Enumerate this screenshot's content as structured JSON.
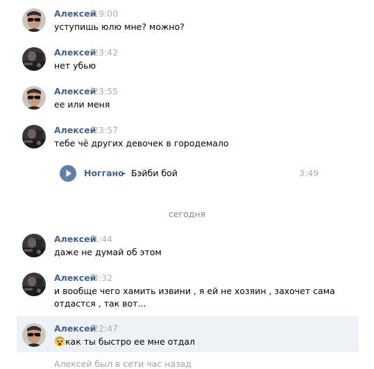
{
  "messages": [
    {
      "author": "Алексей",
      "time": "19:00",
      "text": "уступишь юлю мне? можно?",
      "avatar": "sunglasses"
    },
    {
      "author": "Алексей",
      "time": "23:42",
      "text": "нет убью",
      "avatar": "dark"
    },
    {
      "author": "Алексей",
      "time": "23:55",
      "text": "ее или меня",
      "avatar": "sunglasses"
    },
    {
      "author": "Алексей",
      "time": "23:57",
      "text": "тебе чё других девочек в городемало",
      "avatar": "dark"
    },
    {
      "author": "Алексей",
      "time": "1:44",
      "text": "даже не думай об этом",
      "avatar": "dark"
    },
    {
      "author": "Алексей",
      "time": "3:32",
      "text": "и вообще чего хамить извини , я ей не хозяин , захочет сама отдастся , так вот...",
      "avatar": "dark"
    },
    {
      "author": "Алексей",
      "time": "22:47",
      "text": "как ты быстро ее мне отдал",
      "avatar": "sunglasses",
      "emoji": "fearful-face-icon"
    }
  ],
  "audio": {
    "artist": "Ноггано",
    "separator": "–",
    "title": "Бэйби бой",
    "duration": "3:49",
    "icon": "play-icon"
  },
  "day_separator": "сегодня",
  "status": "Алексей был в сети час назад",
  "colors": {
    "author": "#42648b",
    "time": "#a8aeb6",
    "play_button": "#5e81a8",
    "highlight": "#eef2f6"
  }
}
